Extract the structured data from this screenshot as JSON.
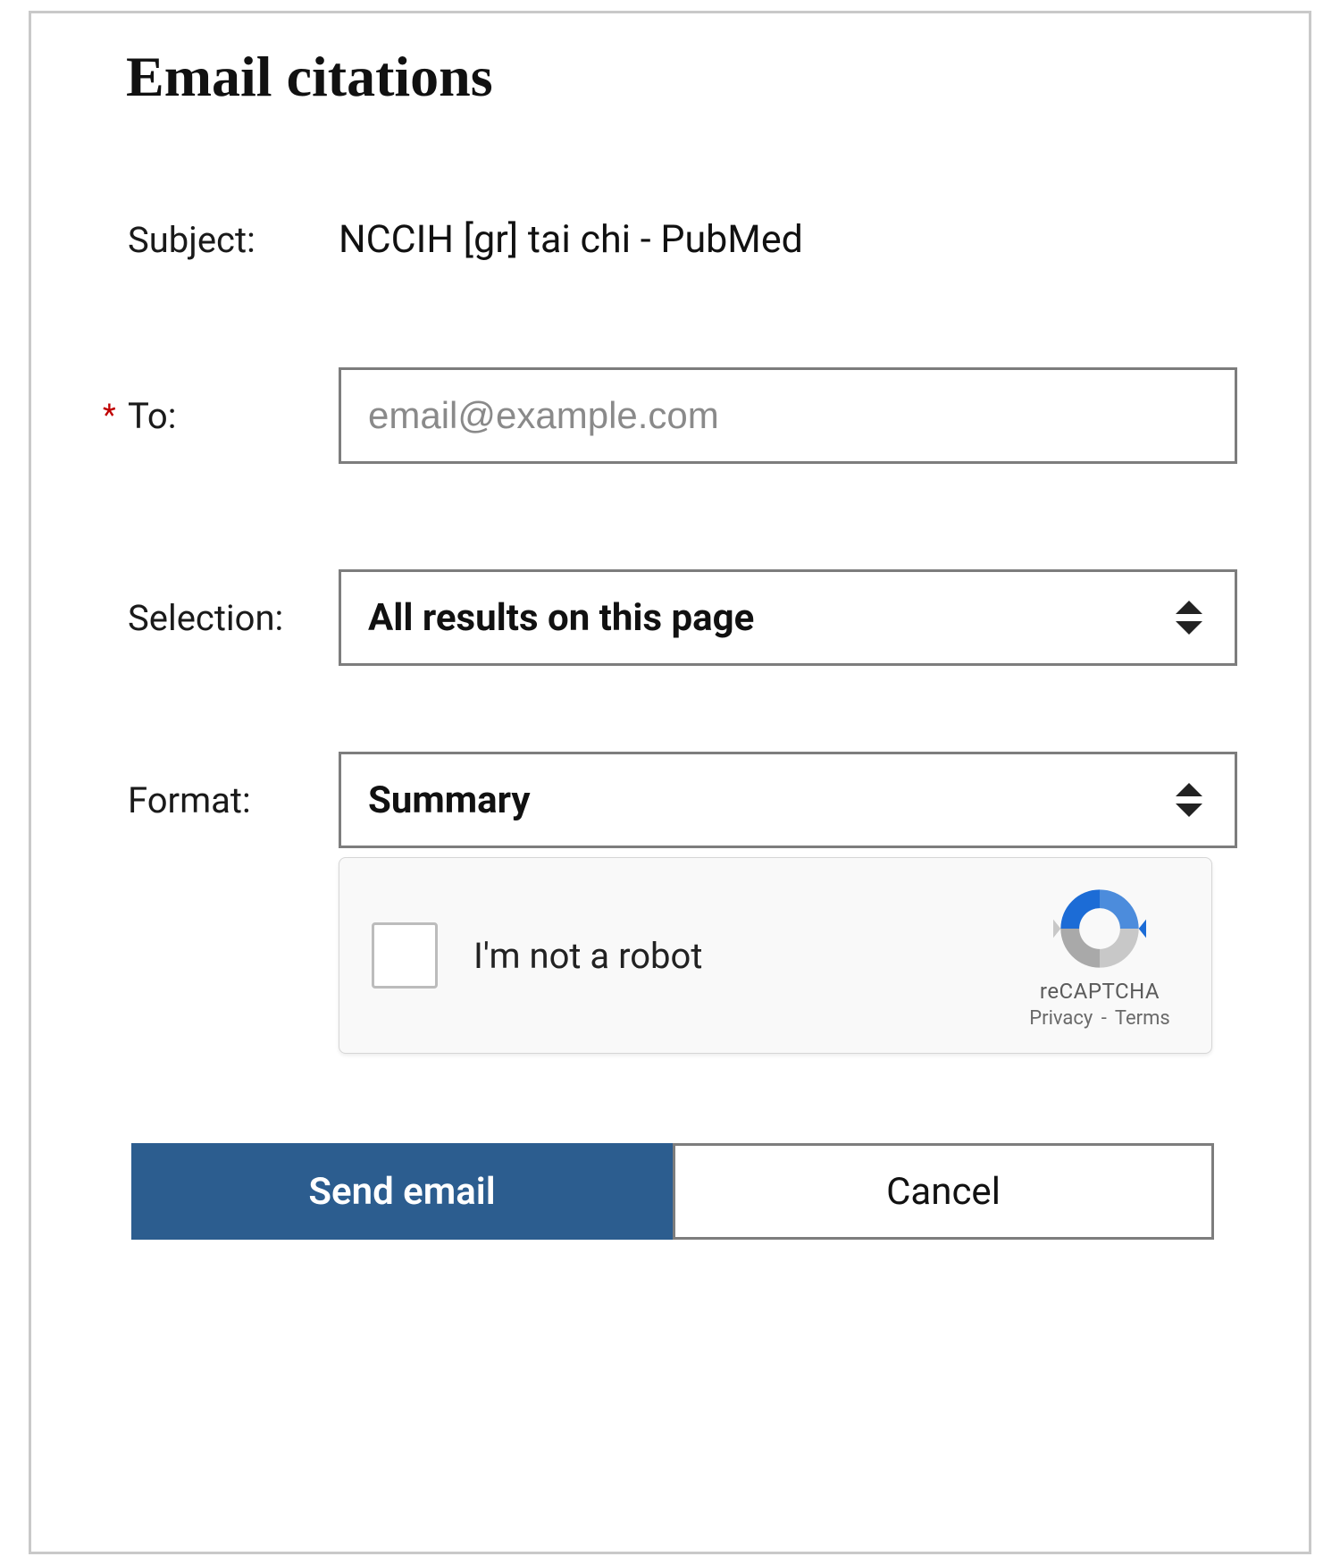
{
  "title": "Email citations",
  "form": {
    "subject": {
      "label": "Subject:",
      "value": "NCCIH [gr] tai chi - PubMed"
    },
    "to": {
      "label": "To:",
      "placeholder": "email@example.com",
      "value": "",
      "required": true
    },
    "selection": {
      "label": "Selection:",
      "value": "All results on this page"
    },
    "format": {
      "label": "Format:",
      "value": "Summary"
    }
  },
  "recaptcha": {
    "label": "I'm not a robot",
    "brand": "reCAPTCHA",
    "privacy": "Privacy",
    "terms": "Terms"
  },
  "actions": {
    "send": "Send email",
    "cancel": "Cancel"
  }
}
